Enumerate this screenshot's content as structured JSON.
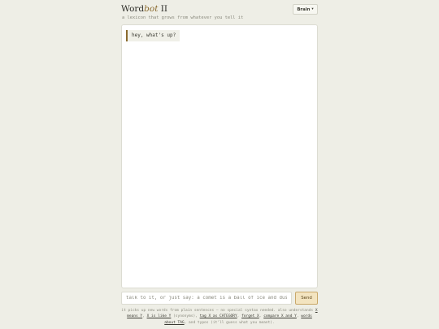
{
  "header": {
    "logo_part1": "Word",
    "logo_accent": "bot",
    "logo_part2": " II",
    "subtitle": "a lexicon that grows from whatever you tell it",
    "brain_label": "Brain",
    "brain_caret": "▾"
  },
  "chat": {
    "messages": [
      {
        "text": "hey, what's up?"
      }
    ]
  },
  "composer": {
    "placeholder": "talk to it, or just say: a comet is a ball of ice and dust",
    "send_label": "Send"
  },
  "help": {
    "t1": "it picks up new words from plain sentences — no special syntax needed. also understands ",
    "c1": "X means Y",
    "t2": ", ",
    "c2": "X is like Y",
    "t3": " (synonyms), ",
    "c3": "tag X as CATEGORY",
    "t4": ", ",
    "c4": "forget X",
    "t5": ", ",
    "c5": "compare X and Y",
    "t6": ", ",
    "c6": "words about TAG",
    "t7": ", and typos (it'll guess what you meant)."
  }
}
